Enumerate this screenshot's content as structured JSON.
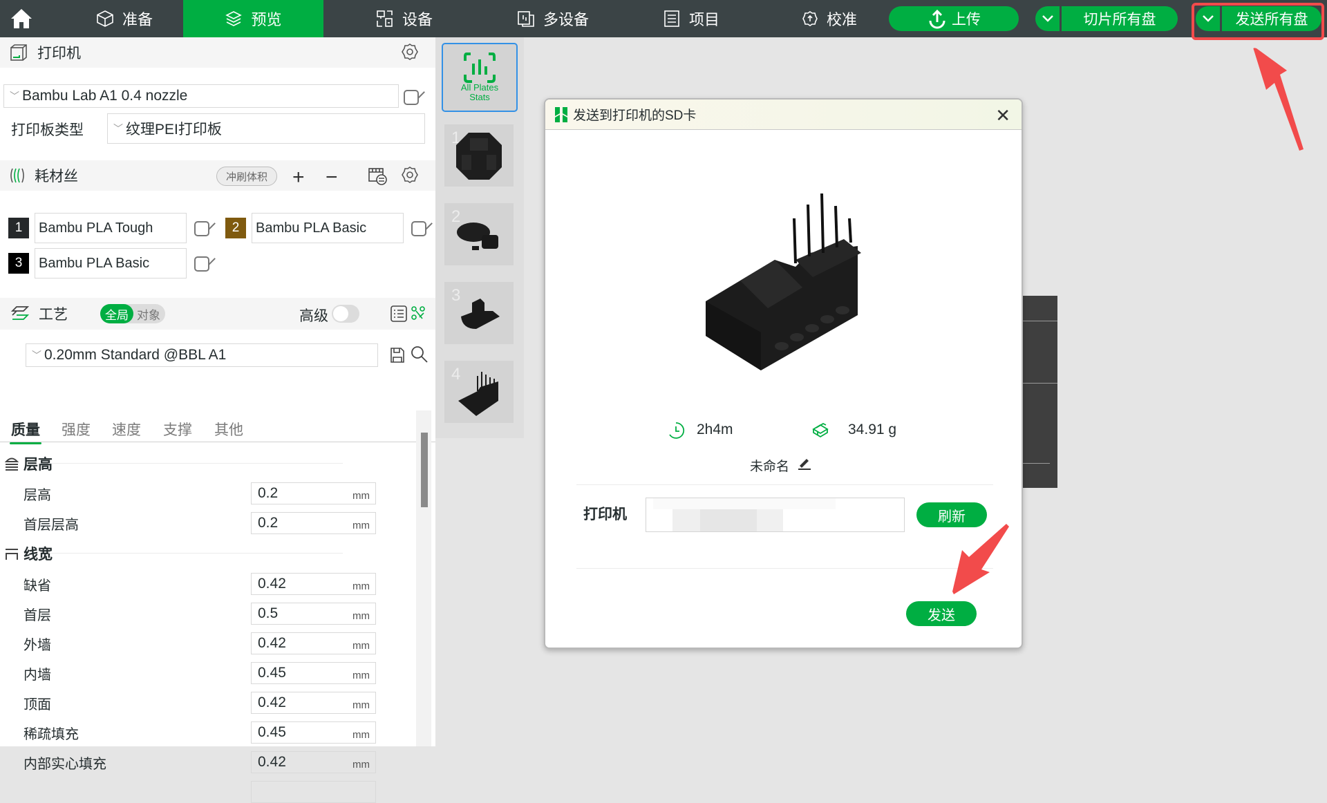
{
  "topbar": {
    "home_icon": "home-icon",
    "tabs": [
      {
        "label": "准备",
        "icon": "cube-icon"
      },
      {
        "label": "预览",
        "icon": "layers-icon",
        "active": true
      },
      {
        "label": "设备",
        "icon": "device-icon"
      },
      {
        "label": "多设备",
        "icon": "multi-device-icon"
      },
      {
        "label": "项目",
        "icon": "list-icon"
      },
      {
        "label": "校准",
        "icon": "calibration-icon"
      }
    ],
    "upload_label": "上传",
    "slice_all_label": "切片所有盘",
    "send_all_label": "发送所有盘"
  },
  "sidebar": {
    "printer": {
      "title": "打印机",
      "preset": "Bambu Lab A1 0.4 nozzle",
      "plate_type_label": "打印板类型",
      "plate_type": "纹理PEI打印板"
    },
    "filament": {
      "title": "耗材丝",
      "flush_label": "冲刷体积",
      "items": [
        {
          "num": "1",
          "name": "Bambu PLA Tough",
          "color": "#25282a"
        },
        {
          "num": "2",
          "name": "Bambu PLA Basic",
          "color": "#7f5a0f"
        },
        {
          "num": "3",
          "name": "Bambu PLA Basic",
          "color": "#000000"
        }
      ]
    },
    "process": {
      "title": "工艺",
      "scope_global": "全局",
      "scope_object": "对象",
      "advanced_label": "高级",
      "advanced_on": false,
      "preset": "0.20mm Standard @BBL A1",
      "tabs": [
        "质量",
        "强度",
        "速度",
        "支撑",
        "其他"
      ],
      "active_tab": "质量",
      "groups": [
        {
          "title": "层高",
          "params": [
            {
              "label": "层高",
              "value": "0.2",
              "unit": "mm"
            },
            {
              "label": "首层层高",
              "value": "0.2",
              "unit": "mm"
            }
          ]
        },
        {
          "title": "线宽",
          "params": [
            {
              "label": "缺省",
              "value": "0.42",
              "unit": "mm"
            },
            {
              "label": "首层",
              "value": "0.5",
              "unit": "mm"
            },
            {
              "label": "外墙",
              "value": "0.42",
              "unit": "mm"
            },
            {
              "label": "内墙",
              "value": "0.45",
              "unit": "mm"
            },
            {
              "label": "顶面",
              "value": "0.42",
              "unit": "mm"
            },
            {
              "label": "稀疏填充",
              "value": "0.45",
              "unit": "mm"
            },
            {
              "label": "内部实心填充",
              "value": "0.42",
              "unit": "mm"
            }
          ]
        }
      ]
    }
  },
  "plates": {
    "all_label_1": "All Plates",
    "all_label_2": "Stats",
    "items": [
      "1",
      "2",
      "3",
      "4"
    ]
  },
  "dialog": {
    "title": "发送到打印机的SD卡",
    "time": "2h4m",
    "weight": "34.91 g",
    "name": "未命名",
    "printer_label": "打印机",
    "refresh_label": "刷新",
    "send_label": "发送"
  },
  "colors": {
    "accent": "#00ae42",
    "topbar": "#3b4446",
    "annotation": "#f24b4b"
  }
}
